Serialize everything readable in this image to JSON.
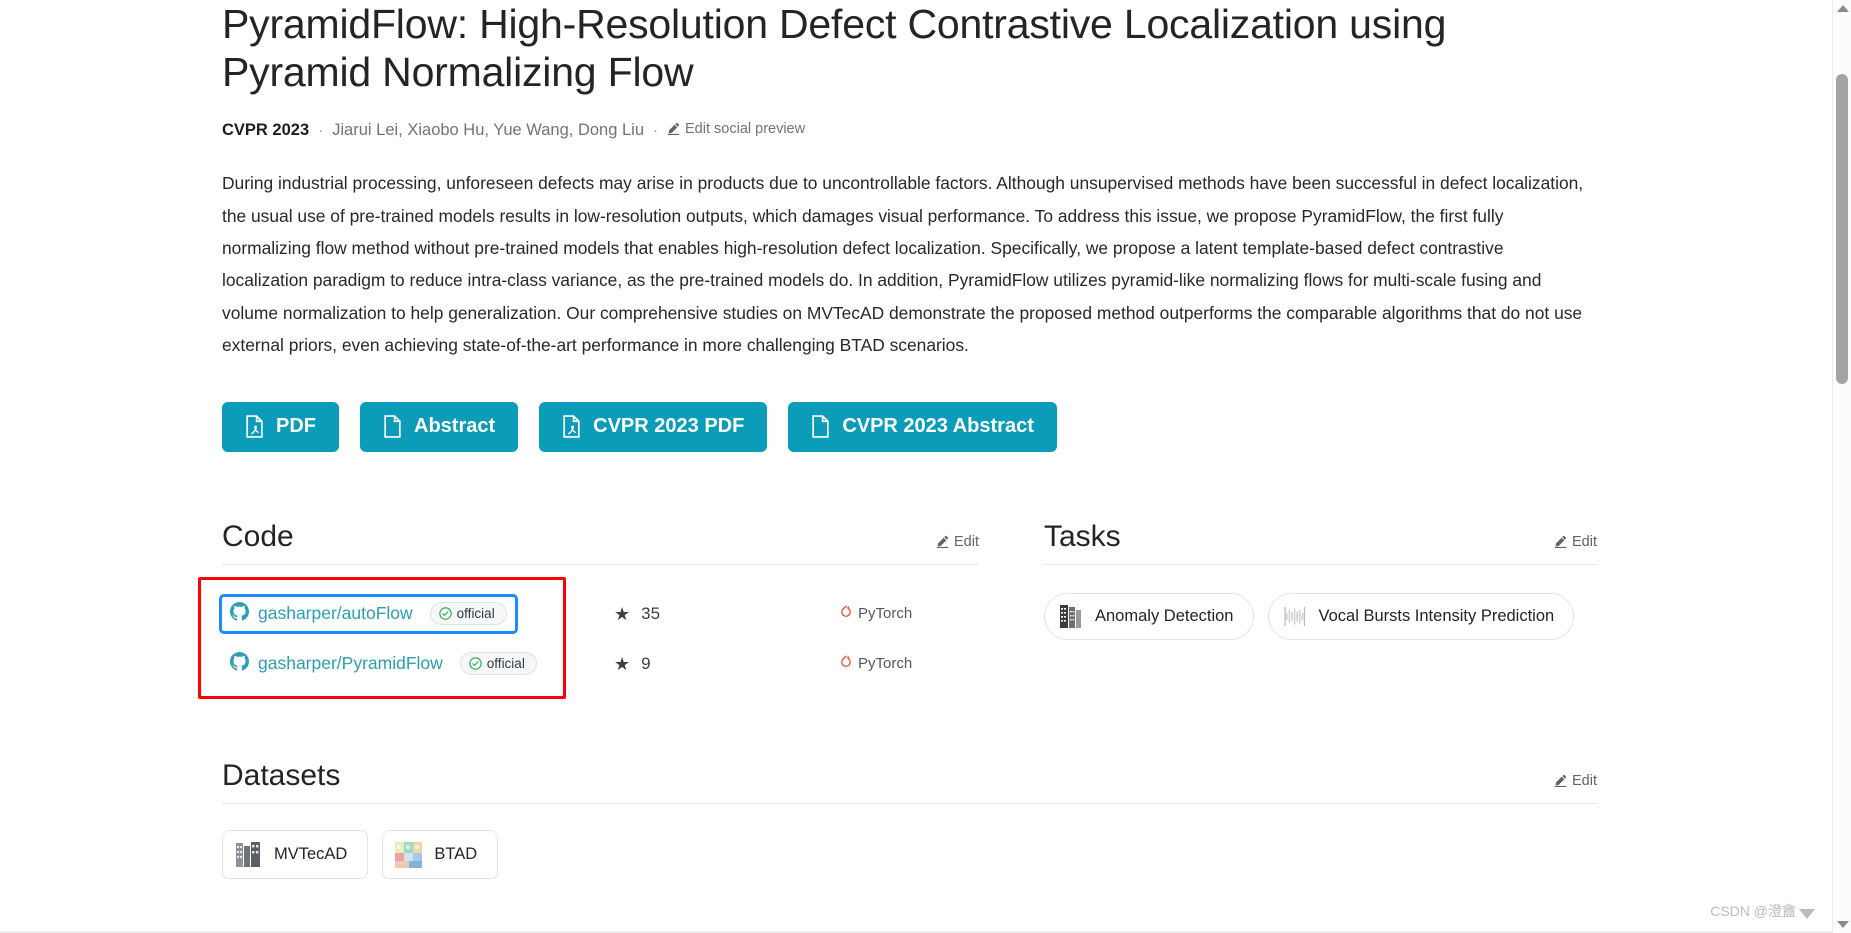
{
  "paper": {
    "title": "PyramidFlow: High-Resolution Defect Contrastive Localization using Pyramid Normalizing Flow",
    "venue": "CVPR 2023",
    "authors": "Jiarui Lei, Xiaobo Hu, Yue Wang, Dong Liu",
    "edit_social_label": "Edit social preview",
    "separator": "·",
    "abstract": "During industrial processing, unforeseen defects may arise in products due to uncontrollable factors. Although unsupervised methods have been successful in defect localization, the usual use of pre-trained models results in low-resolution outputs, which damages visual performance. To address this issue, we propose PyramidFlow, the first fully normalizing flow method without pre-trained models that enables high-resolution defect localization. Specifically, we propose a latent template-based defect contrastive localization paradigm to reduce intra-class variance, as the pre-trained models do. In addition, PyramidFlow utilizes pyramid-like normalizing flows for multi-scale fusing and volume normalization to help generalization. Our comprehensive studies on MVTecAD demonstrate the proposed method outperforms the comparable algorithms that do not use external priors, even achieving state-of-the-art performance in more challenging BTAD scenarios."
  },
  "action_buttons": [
    {
      "label": "PDF",
      "icon": "pdf-file-icon"
    },
    {
      "label": "Abstract",
      "icon": "blank-file-icon"
    },
    {
      "label": "CVPR 2023 PDF",
      "icon": "pdf-file-icon"
    },
    {
      "label": "CVPR 2023 Abstract",
      "icon": "blank-file-icon"
    }
  ],
  "code_section": {
    "title": "Code",
    "edit_label": "Edit",
    "repos": [
      {
        "name": "gasharper/autoFlow",
        "badge": "official",
        "stars": "35",
        "framework": "PyTorch",
        "focused": true
      },
      {
        "name": "gasharper/PyramidFlow",
        "badge": "official",
        "stars": "9",
        "framework": "PyTorch",
        "focused": false
      }
    ]
  },
  "tasks_section": {
    "title": "Tasks",
    "edit_label": "Edit",
    "tasks": [
      {
        "label": "Anomaly Detection",
        "thumb": "anomaly-detection-thumbnail"
      },
      {
        "label": "Vocal Bursts Intensity Prediction",
        "thumb": "vocal-bursts-thumbnail"
      }
    ]
  },
  "datasets_section": {
    "title": "Datasets",
    "edit_label": "Edit",
    "datasets": [
      {
        "label": "MVTecAD",
        "thumb": "mvtecad-thumbnail"
      },
      {
        "label": "BTAD",
        "thumb": "btad-thumbnail"
      }
    ]
  },
  "watermark": {
    "text": "CSDN @澄盦"
  },
  "colors": {
    "accent_teal": "#0a9cb8",
    "link_blue": "#2c9fb5",
    "highlight_red": "#ff0000",
    "focus_blue": "#1a8cff",
    "pytorch_orange": "#ee4c2c",
    "badge_green": "#2ea44f"
  }
}
